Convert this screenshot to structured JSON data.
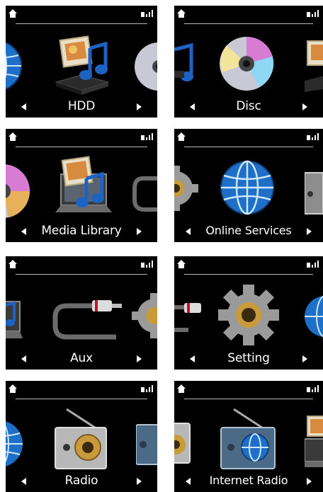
{
  "panels": [
    {
      "label": "HDD",
      "left_icon": "globe-icon",
      "center_icon": "hdd-music-icon",
      "right_icon": "disc-icon"
    },
    {
      "label": "Disc",
      "left_icon": "music-note-icon",
      "center_icon": "disc-icon",
      "right_icon": "hdd-music-icon"
    },
    {
      "label": "Media Library",
      "left_icon": "disc-icon",
      "center_icon": "media-library-laptop-icon",
      "right_icon": "aux-cable-icon"
    },
    {
      "label": "Online Services",
      "left_icon": "gear-icon",
      "center_icon": "globe-icon",
      "right_icon": "radio-icon"
    },
    {
      "label": "Aux",
      "left_icon": "media-library-laptop-icon",
      "center_icon": "aux-cable-icon",
      "right_icon": "gear-icon"
    },
    {
      "label": "Setting",
      "left_icon": "aux-cable-icon",
      "center_icon": "gear-icon",
      "right_icon": "globe-icon"
    },
    {
      "label": "Radio",
      "left_icon": "globe-icon",
      "center_icon": "radio-icon",
      "right_icon": "internet-radio-icon"
    },
    {
      "label": "Internet Radio",
      "left_icon": "radio-icon",
      "center_icon": "internet-radio-icon",
      "right_icon": "media-library-laptop-icon"
    }
  ],
  "status": {
    "home_icon": "home-icon",
    "signal_icon": "signal-strength-icon"
  },
  "colors": {
    "screen_background": "#000000",
    "text": "#ffffff",
    "globe_blue": "#1e6fc8",
    "gear_gray": "#9a9a9a",
    "speaker_gold": "#c89a3a"
  }
}
